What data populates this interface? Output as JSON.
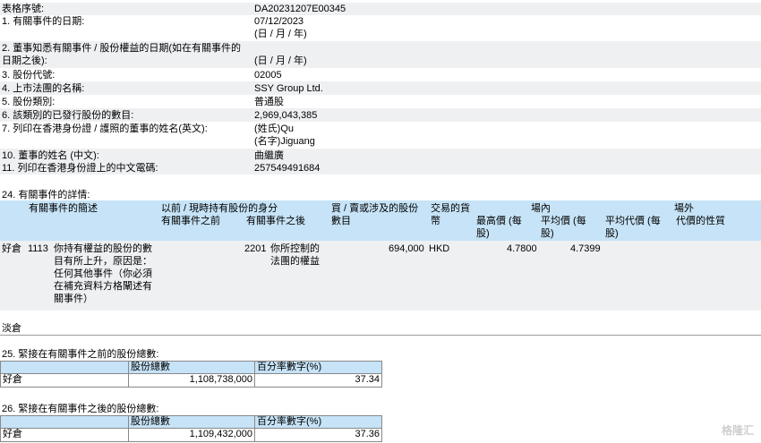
{
  "top": [
    {
      "label": "表格序號:",
      "value": "DA20231207E00345"
    },
    {
      "label": "1. 有關事件的日期:",
      "value": "07/12/2023",
      "sub": "(日 / 月 / 年)"
    },
    {
      "label": "2. 董事知悉有關事件 / 股份權益的日期(如在有關事件的",
      "label2": "日期之後):",
      "value": "(日 / 月 / 年)"
    },
    {
      "label": "3. 股份代號:",
      "value": "02005"
    },
    {
      "label": "4. 上市法團的名稱:",
      "value": "SSY Group Ltd."
    },
    {
      "label": "5. 股份類別:",
      "value": "普通股"
    },
    {
      "label": "6. 該類別的已發行股份的數目:",
      "value": "2,969,043,385"
    },
    {
      "label": "7. 列印在香港身份證 / 護照的董事的姓名(英文):",
      "value": "(姓氏)Qu",
      "sub": "(名字)Jiguang"
    },
    {
      "label": "10. 董事的姓名 (中文):",
      "value": "曲繼廣"
    },
    {
      "label": "11. 列印在香港身份證上的中文電碼:",
      "value": "257549491684"
    }
  ],
  "section24": {
    "title": "24. 有關事件的詳情:",
    "headers": {
      "event_code": "有關事件的簡述",
      "capacity": "以前 / 現時持有股份的身分",
      "capacity_before": "有關事件之前",
      "capacity_after": "有關事件之後",
      "shares_involved": "買 / 賣或涉及的股份數目",
      "currency": "交易的貨幣",
      "on_exchange": "場內",
      "highest": "最高價 (每股)",
      "average": "平均價 (每股)",
      "off_exchange": "場外",
      "avg_consideration": "平均代價 (每股)",
      "nature": "代價的性質"
    },
    "rows": [
      {
        "position": "好倉",
        "code": "1113",
        "description": "你持有權益的股份的數目有所上升，原因是：任何其他事件（你必須在補充資料方格闡述有關事件）",
        "capacity_before": "",
        "capacity_after_code": "2201",
        "capacity_after": "你所控制的法團的權益",
        "shares": "694,000",
        "currency": "HKD",
        "highest": "4.7800",
        "average": "4.7399",
        "avg_consideration": "",
        "nature": ""
      },
      {
        "position": "淡倉"
      }
    ]
  },
  "section25": {
    "title": "25. 緊接在有關事件之前的股份總數:",
    "col_shares": "股份總數",
    "col_pct": "百分率數字(%)",
    "row_label": "好倉",
    "shares": "1,108,738,000",
    "pct": "37.34"
  },
  "section26": {
    "title": "26. 緊接在有關事件之後的股份總數:",
    "col_shares": "股份總數",
    "col_pct": "百分率數字(%)",
    "row_label": "好倉",
    "shares": "1,109,432,000",
    "pct": "37.36"
  },
  "watermark": "格隆汇"
}
